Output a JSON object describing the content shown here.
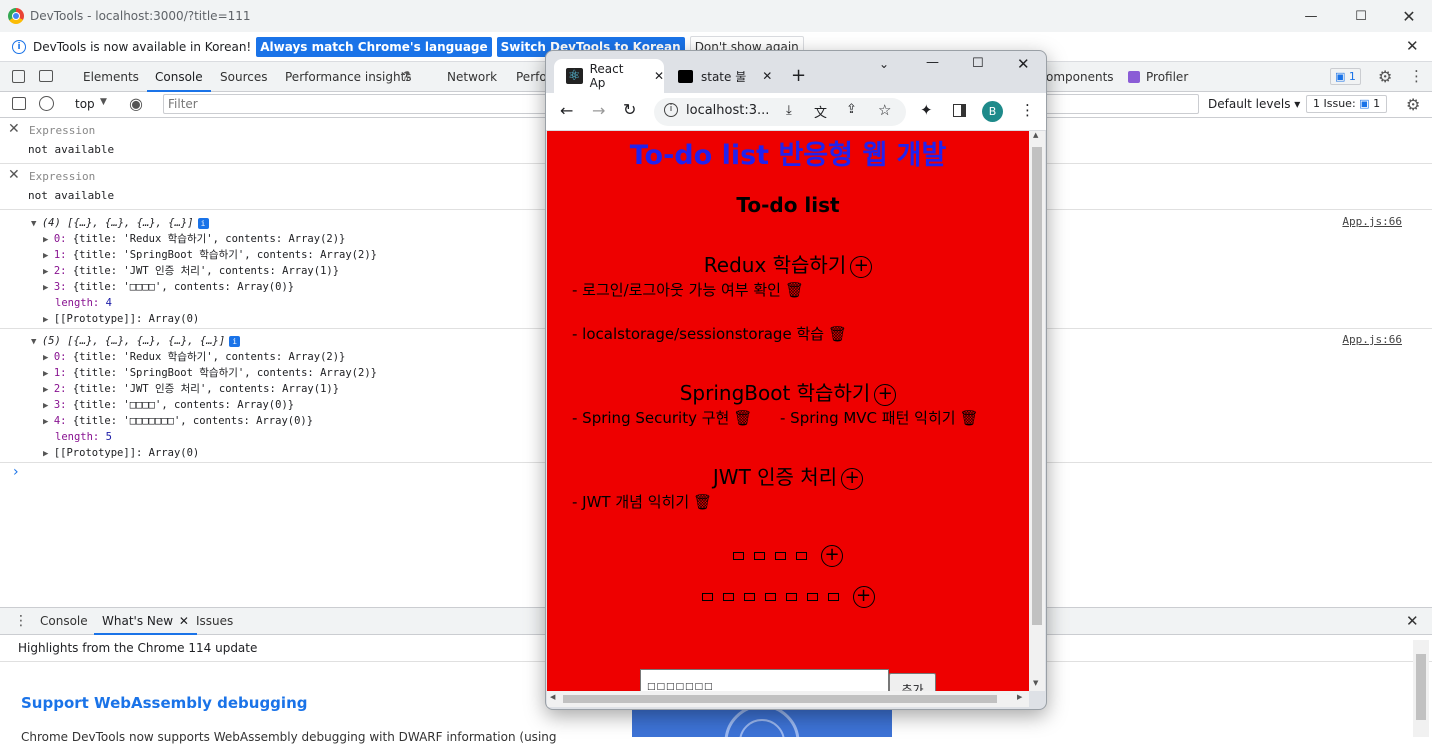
{
  "window": {
    "title": "DevTools - localhost:3000/?title=111"
  },
  "infobar": {
    "message": "DevTools is now available in Korean!",
    "btn_match": "Always match Chrome's language",
    "btn_switch": "Switch DevTools to Korean",
    "btn_dismiss": "Don't show again"
  },
  "devtools_tabs": [
    "Elements",
    "Console",
    "Sources",
    "Performance insights",
    "Network",
    "Perfo",
    "omponents",
    "Profiler"
  ],
  "devtools_badge": "1",
  "console_toolbar": {
    "context": "top",
    "filter_placeholder": "Filter",
    "levels": "Default levels",
    "issues": "1 Issue:",
    "issues_count": "1"
  },
  "expressions": [
    {
      "label": "Expression",
      "value": "not available"
    },
    {
      "label": "Expression",
      "value": "not available"
    }
  ],
  "logs": [
    {
      "header": "(4) [{…}, {…}, {…}, {…}]",
      "source": "App.js:66",
      "items": [
        {
          "idx": "0:",
          "text": "{title: 'Redux 학습하기', contents: Array(2)}"
        },
        {
          "idx": "1:",
          "text": "{title: 'SpringBoot 학습하기', contents: Array(2)}"
        },
        {
          "idx": "2:",
          "text": "{title: 'JWT 인증 처리', contents: Array(1)}"
        },
        {
          "idx": "3:",
          "text": "{title: '□□□□', contents: Array(0)}"
        }
      ],
      "length_label": "length:",
      "length_value": "4",
      "proto": "[[Prototype]]: Array(0)"
    },
    {
      "header": "(5) [{…}, {…}, {…}, {…}, {…}]",
      "source": "App.js:66",
      "items": [
        {
          "idx": "0:",
          "text": "{title: 'Redux 학습하기', contents: Array(2)}"
        },
        {
          "idx": "1:",
          "text": "{title: 'SpringBoot 학습하기', contents: Array(2)}"
        },
        {
          "idx": "2:",
          "text": "{title: 'JWT 인증 처리', contents: Array(1)}"
        },
        {
          "idx": "3:",
          "text": "{title: '□□□□', contents: Array(0)}"
        },
        {
          "idx": "4:",
          "text": "{title: '□□□□□□□', contents: Array(0)}"
        }
      ],
      "length_label": "length:",
      "length_value": "5",
      "proto": "[[Prototype]]: Array(0)"
    }
  ],
  "prompt": "›",
  "drawer": {
    "tabs": [
      "Console",
      "What's New",
      "Issues"
    ],
    "highlights": "Highlights from the Chrome 114 update",
    "wn_title": "Support WebAssembly debugging",
    "wn_text": "Chrome DevTools now supports WebAssembly debugging with DWARF information (using"
  },
  "popup": {
    "tab1": "React Ap",
    "tab2": "state 불",
    "url": "localhost:3...",
    "avatar": "B",
    "page": {
      "h1": "To-do list 반응형 웹 개발",
      "h2": "To-do list",
      "groups": [
        {
          "title": "Redux 학습하기",
          "items": [
            "- 로그인/로그아웃 가능 여부 확인",
            "- localstorage/sessionstorage 학습"
          ]
        },
        {
          "title": "SpringBoot 학습하기",
          "items": [
            "- Spring Security 구현",
            "- Spring MVC 패턴 익히기"
          ]
        },
        {
          "title": "JWT 인증 처리",
          "items": [
            "- JWT 개념 익히기"
          ]
        }
      ],
      "tofu_row1": 4,
      "tofu_row2": 7,
      "input_value": "□□□□□□□",
      "add_button": "추가"
    }
  },
  "colors": {
    "accent": "#1a73e8",
    "page_bg": "#ee0000",
    "heading": "#2222ee"
  }
}
